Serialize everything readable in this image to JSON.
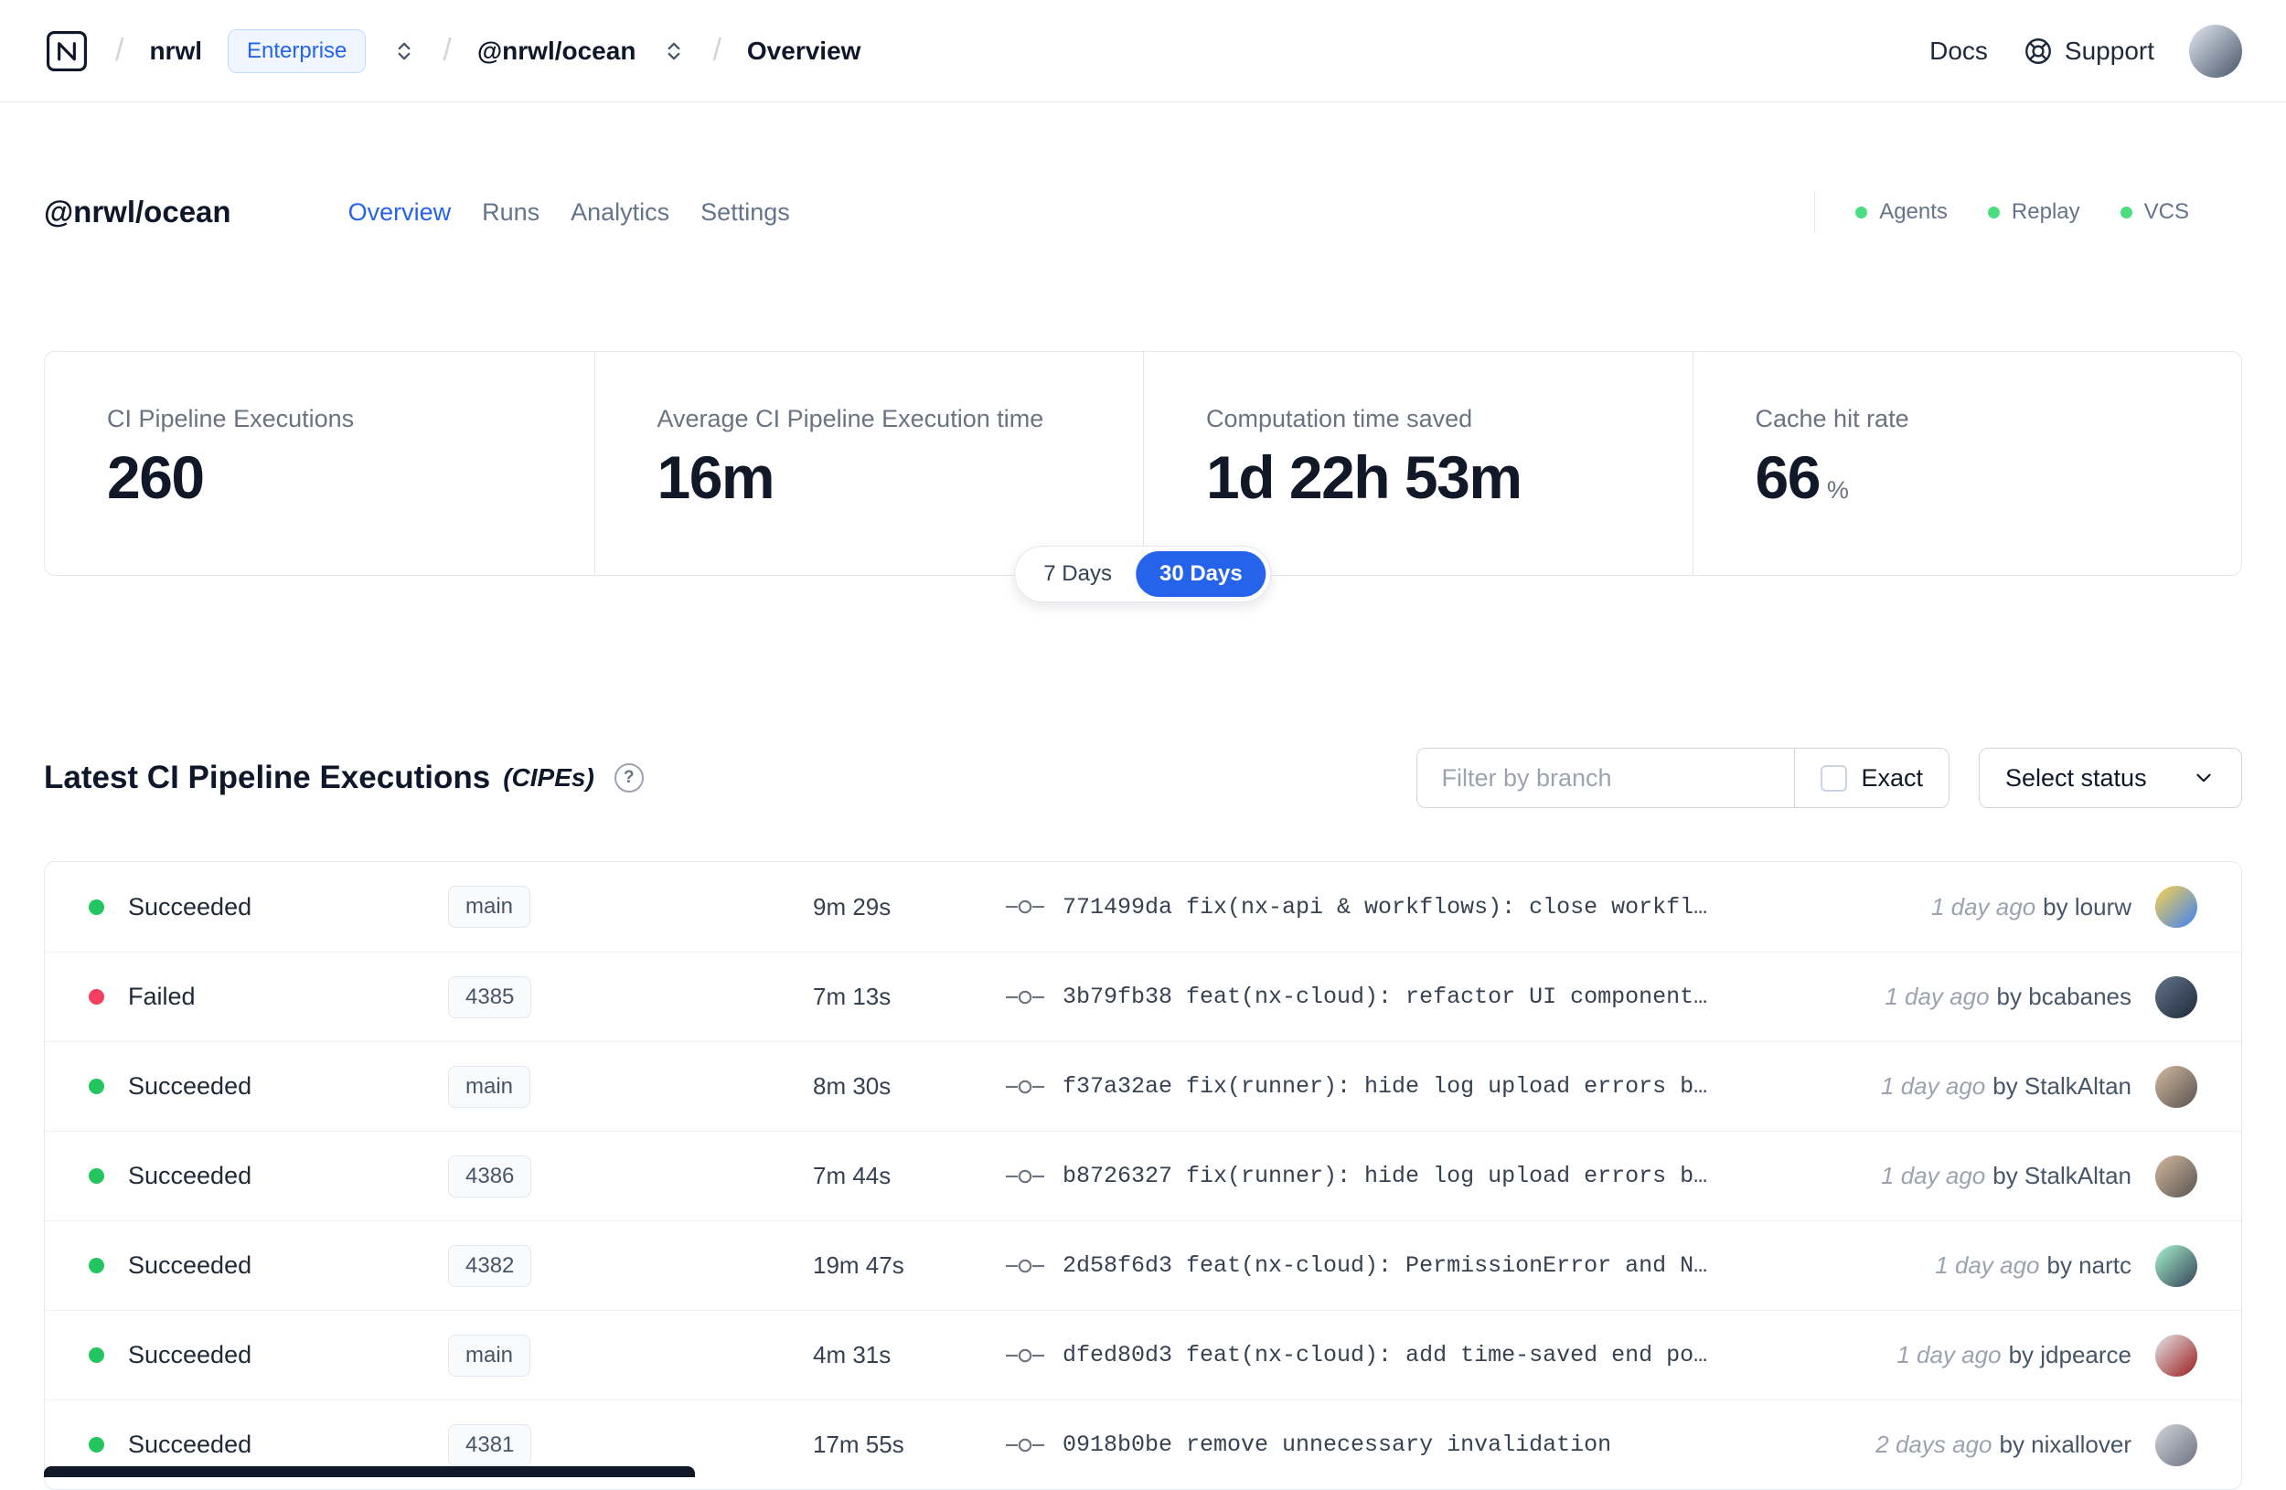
{
  "navbar": {
    "breadcrumb": {
      "org": "nrwl",
      "plan": "Enterprise",
      "workspace": "@nrwl/ocean",
      "page": "Overview"
    },
    "docs": "Docs",
    "support": "Support",
    "avatar_colors": {
      "from": "#e2e8f0",
      "to": "#475569"
    }
  },
  "workspace_header": {
    "title": "@nrwl/ocean",
    "tabs": [
      {
        "label": "Overview",
        "active": true
      },
      {
        "label": "Runs",
        "active": false
      },
      {
        "label": "Analytics",
        "active": false
      },
      {
        "label": "Settings",
        "active": false
      }
    ],
    "integrations": [
      {
        "label": "Agents"
      },
      {
        "label": "Replay"
      },
      {
        "label": "VCS"
      }
    ],
    "integration_dot_color": "#4ade80"
  },
  "stats": {
    "cards": [
      {
        "label": "CI Pipeline Executions",
        "value": "260"
      },
      {
        "label": "Average CI Pipeline Execution time",
        "value": "16m"
      },
      {
        "label": "Computation time saved",
        "value": "1d 22h 53m"
      },
      {
        "label": "Cache hit rate",
        "value": "66",
        "unit": "%"
      }
    ],
    "range_toggle": {
      "options": [
        "7 Days",
        "30 Days"
      ],
      "selected": "30 Days"
    }
  },
  "cipe": {
    "title": "Latest CI Pipeline Executions",
    "suffix": "(CIPEs)",
    "help_glyph": "?",
    "filter_placeholder": "Filter by branch",
    "exact_label": "Exact",
    "select_status_label": "Select status",
    "status_colors": {
      "success": "#22c55e",
      "failed": "#f43f5e"
    },
    "rows": [
      {
        "status": "Succeeded",
        "color": "success",
        "branch": "main",
        "duration": "9m 29s",
        "commit": "771499da fix(nx-api & workflows): close workfl…",
        "time": "1 day ago",
        "author": "by lourw",
        "avatar": {
          "from": "#fcd34d",
          "to": "#3b82f6"
        }
      },
      {
        "status": "Failed",
        "color": "failed",
        "branch": "4385",
        "duration": "7m 13s",
        "commit": "3b79fb38 feat(nx-cloud): refactor UI component…",
        "time": "1 day ago",
        "author": "by bcabanes",
        "avatar": {
          "from": "#64748b",
          "to": "#1e293b"
        }
      },
      {
        "status": "Succeeded",
        "color": "success",
        "branch": "main",
        "duration": "8m 30s",
        "commit": "f37a32ae fix(runner): hide log upload errors b…",
        "time": "1 day ago",
        "author": "by StalkAltan",
        "avatar": {
          "from": "#d4b8a0",
          "to": "#57534e"
        }
      },
      {
        "status": "Succeeded",
        "color": "success",
        "branch": "4386",
        "duration": "7m 44s",
        "commit": "b8726327 fix(runner): hide log upload errors b…",
        "time": "1 day ago",
        "author": "by StalkAltan",
        "avatar": {
          "from": "#d4b8a0",
          "to": "#57534e"
        }
      },
      {
        "status": "Succeeded",
        "color": "success",
        "branch": "4382",
        "duration": "19m 47s",
        "commit": "2d58f6d3 feat(nx-cloud): PermissionError and N…",
        "time": "1 day ago",
        "author": "by nartc",
        "avatar": {
          "from": "#a7f3d0",
          "to": "#334155"
        }
      },
      {
        "status": "Succeeded",
        "color": "success",
        "branch": "main",
        "duration": "4m 31s",
        "commit": "dfed80d3 feat(nx-cloud): add time-saved end po…",
        "time": "1 day ago",
        "author": "by jdpearce",
        "avatar": {
          "from": "#e5e7eb",
          "to": "#991b1b"
        }
      },
      {
        "status": "Succeeded",
        "color": "success",
        "branch": "4381",
        "duration": "17m 55s",
        "commit": "0918b0be remove unnecessary invalidation",
        "time": "2 days ago",
        "author": "by nixallover",
        "avatar": {
          "from": "#d1d5db",
          "to": "#6b7280"
        }
      }
    ]
  }
}
